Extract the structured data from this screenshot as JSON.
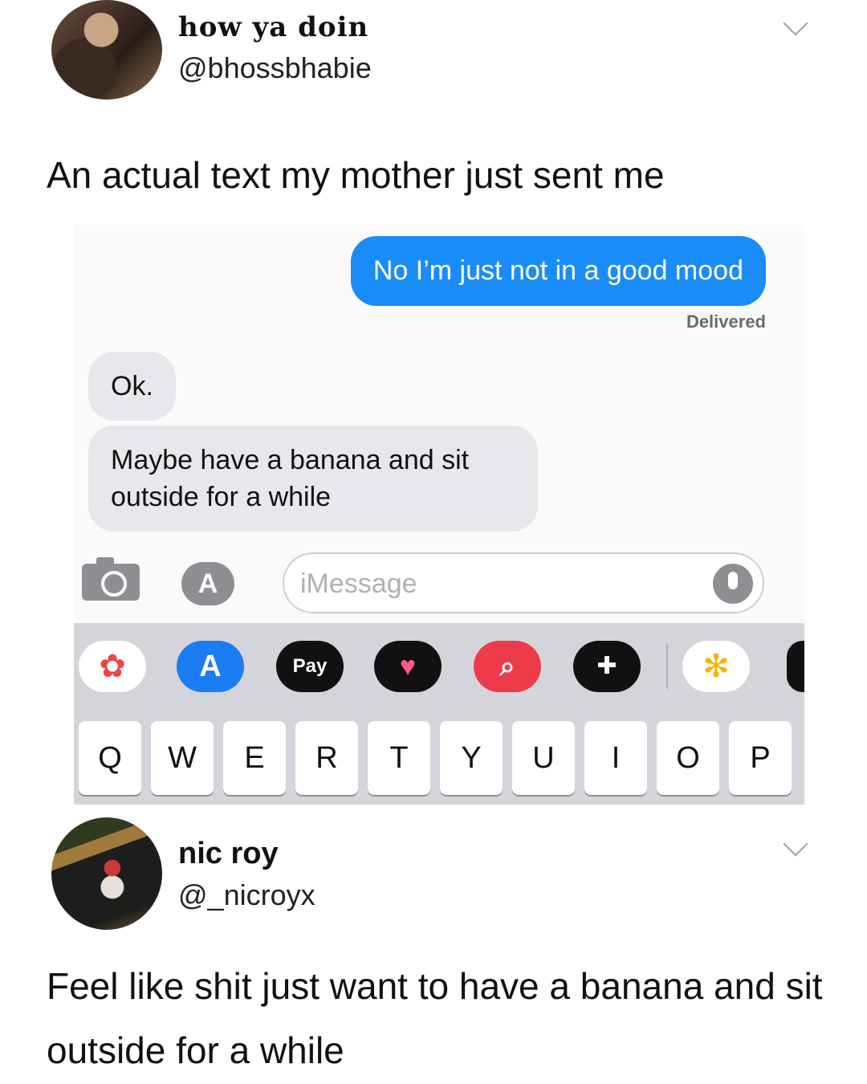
{
  "tweet1": {
    "display_name": "how ya doin",
    "handle": "@bhossbhabie",
    "text": "An actual text my mother just sent me"
  },
  "screenshot": {
    "sent_message": "No I’m just not in a good mood",
    "delivered_label": "Delivered",
    "received_messages": [
      "Ok.",
      "Maybe have a banana and sit outside for a while"
    ],
    "message_placeholder": "iMessage",
    "apps": {
      "photos_icon": "photos-icon",
      "app_store_icon": "app-store-icon",
      "apple_pay_label": " Pay",
      "heart_icon": "heart-sticker-icon",
      "search_icon": "web-search-icon",
      "game_icon": "game-controller-icon",
      "google_photos_icon": "google-photos-icon"
    },
    "keyboard_keys": [
      "Q",
      "W",
      "E",
      "R",
      "T",
      "Y",
      "U",
      "I",
      "O",
      "P"
    ]
  },
  "tweet2": {
    "display_name": "nic roy",
    "handle": "@_nicroyx",
    "text": "Feel like shit just want to have a banana and sit outside for a while"
  },
  "colors": {
    "sent_bubble": "#1a8cf8",
    "received_bubble": "#e8e8ec",
    "keyboard_bg": "#d4d5da"
  }
}
